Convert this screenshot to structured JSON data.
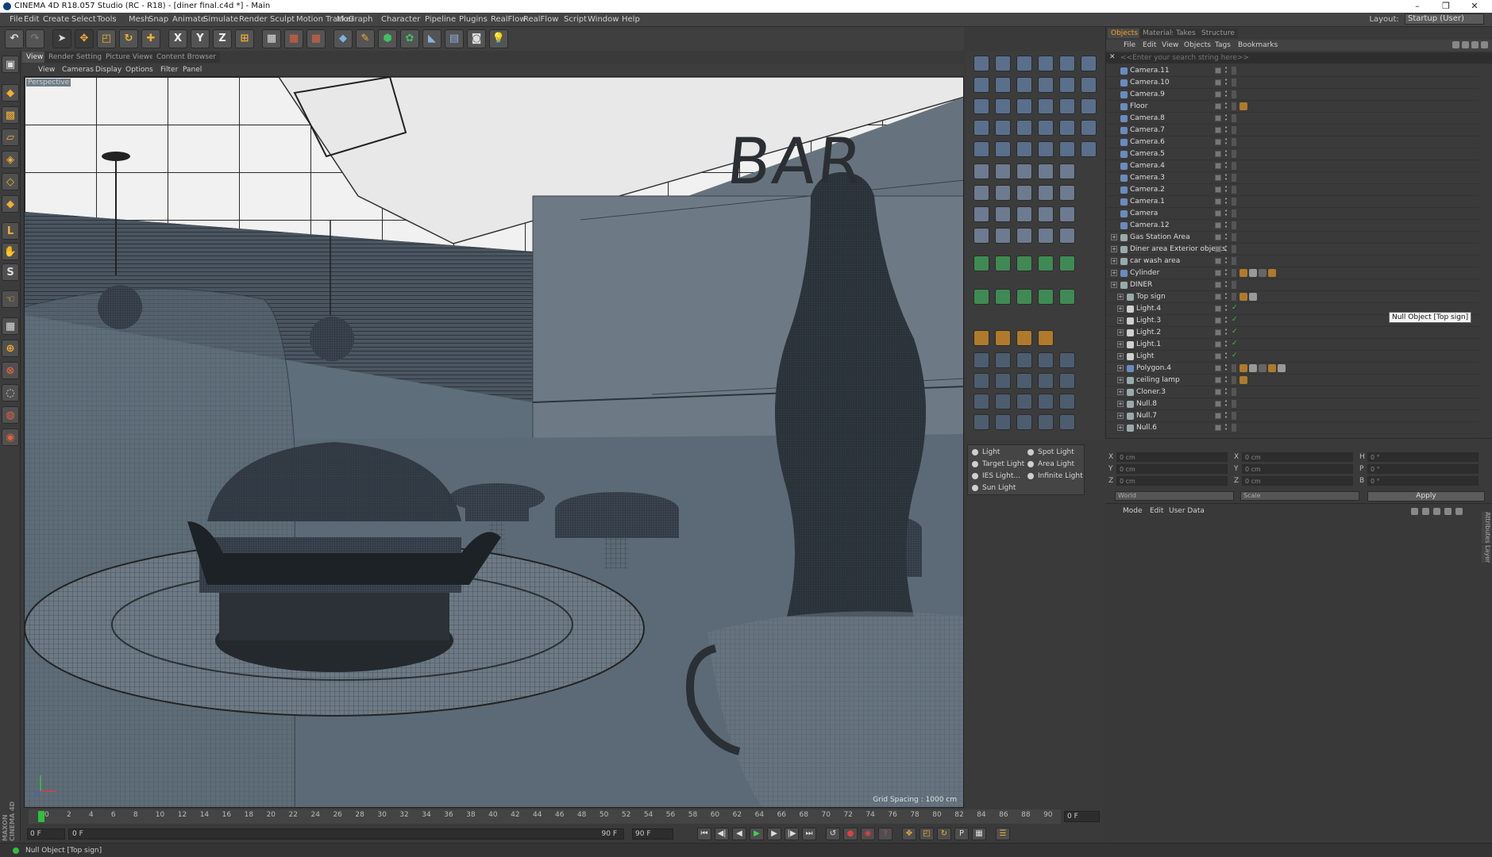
{
  "window": {
    "title": "CINEMA 4D R18.057 Studio (RC - R18) - [diner final.c4d *] - Main"
  },
  "layout": {
    "label": "Layout:",
    "value": "Startup (User)"
  },
  "menu": [
    "File",
    "Edit",
    "Create",
    "Select",
    "Tools",
    "Mesh",
    "Snap",
    "Animate",
    "Simulate",
    "Render",
    "Sculpt",
    "Motion Tracker",
    "MoGraph",
    "Character",
    "Pipeline",
    "Plugins",
    "RealFlow",
    "RealFlow",
    "Script",
    "Window",
    "Help"
  ],
  "viewport_tabs": [
    "View",
    "Render Settings",
    "Picture Viewer",
    "Content Browser"
  ],
  "viewport_menu": [
    "View",
    "Cameras",
    "Display",
    "Options",
    "Filter",
    "Panel"
  ],
  "viewport": {
    "label": "Perspective",
    "grid_spacing": "Grid Spacing : 1000 cm",
    "sign_text": "BAR"
  },
  "toolbar_axes": [
    "X",
    "Y",
    "Z"
  ],
  "lights": [
    {
      "label": "Light"
    },
    {
      "label": "Spot Light"
    },
    {
      "label": "Target Light"
    },
    {
      "label": "Area Light"
    },
    {
      "label": "IES Light..."
    },
    {
      "label": "Infinite Light"
    },
    {
      "label": "Sun Light"
    }
  ],
  "objects_panel": {
    "tabs": [
      "Objects",
      "Materials",
      "Takes",
      "Structure"
    ],
    "menu": [
      "File",
      "Edit",
      "View",
      "Objects",
      "Tags",
      "Bookmarks"
    ],
    "search_placeholder": "<<Enter your search string here>>",
    "rows": [
      {
        "name": "Camera.11",
        "indent": 0,
        "tags": 0
      },
      {
        "name": "Camera.10",
        "indent": 0,
        "tags": 0
      },
      {
        "name": "Camera.9",
        "indent": 0,
        "tags": 0
      },
      {
        "name": "Floor",
        "indent": 0,
        "tags": 1
      },
      {
        "name": "Camera.8",
        "indent": 0,
        "tags": 0
      },
      {
        "name": "Camera.7",
        "indent": 0,
        "tags": 0
      },
      {
        "name": "Camera.6",
        "indent": 0,
        "tags": 0
      },
      {
        "name": "Camera.5",
        "indent": 0,
        "tags": 0
      },
      {
        "name": "Camera.4",
        "indent": 0,
        "tags": 0
      },
      {
        "name": "Camera.3",
        "indent": 0,
        "tags": 0
      },
      {
        "name": "Camera.2",
        "indent": 0,
        "tags": 0
      },
      {
        "name": "Camera.1",
        "indent": 0,
        "tags": 0
      },
      {
        "name": "Camera",
        "indent": 0,
        "tags": 0
      },
      {
        "name": "Camera.12",
        "indent": 0,
        "tags": 0
      },
      {
        "name": "Gas Station Area",
        "indent": 0,
        "tags": 0
      },
      {
        "name": "Diner area Exterior objects",
        "indent": 0,
        "tags": 0
      },
      {
        "name": "car wash area",
        "indent": 0,
        "tags": 0
      },
      {
        "name": "Cylinder",
        "indent": 0,
        "tags": 4
      },
      {
        "name": "DINER",
        "indent": 0,
        "tags": 0
      },
      {
        "name": "Top sign",
        "indent": 1,
        "tags": 2
      },
      {
        "name": "Light.4",
        "indent": 1,
        "tags": 0
      },
      {
        "name": "Light.3",
        "indent": 1,
        "tags": 0
      },
      {
        "name": "Light.2",
        "indent": 1,
        "tags": 0
      },
      {
        "name": "Light.1",
        "indent": 1,
        "tags": 0
      },
      {
        "name": "Light",
        "indent": 1,
        "tags": 0
      },
      {
        "name": "Polygon.4",
        "indent": 1,
        "tags": 5
      },
      {
        "name": "ceiling lamp",
        "indent": 1,
        "tags": 1
      },
      {
        "name": "Cloner.3",
        "indent": 1,
        "tags": 0
      },
      {
        "name": "Null.8",
        "indent": 1,
        "tags": 0
      },
      {
        "name": "Null.7",
        "indent": 1,
        "tags": 0
      },
      {
        "name": "Null.6",
        "indent": 1,
        "tags": 0
      }
    ]
  },
  "tooltip": "Null Object [Top sign]",
  "coords": {
    "rows": [
      {
        "a": "X",
        "av": "0 cm",
        "b": "X",
        "bv": "0 cm",
        "c": "H",
        "cv": "0 °"
      },
      {
        "a": "Y",
        "av": "0 cm",
        "b": "Y",
        "bv": "0 cm",
        "c": "P",
        "cv": "0 °"
      },
      {
        "a": "Z",
        "av": "0 cm",
        "b": "Z",
        "bv": "0 cm",
        "c": "B",
        "cv": "0 °"
      }
    ],
    "space": "World",
    "mode": "Scale",
    "apply": "Apply"
  },
  "attributes": {
    "menu": [
      "Mode",
      "Edit",
      "User Data"
    ],
    "side_tabs": [
      "Attributes",
      "Layer"
    ]
  },
  "timeline": {
    "ticks": [
      "0",
      "2",
      "4",
      "6",
      "8",
      "10",
      "12",
      "14",
      "16",
      "18",
      "20",
      "22",
      "24",
      "26",
      "28",
      "30",
      "32",
      "34",
      "36",
      "38",
      "40",
      "42",
      "44",
      "46",
      "48",
      "50",
      "52",
      "54",
      "56",
      "58",
      "60",
      "62",
      "64",
      "66",
      "68",
      "70",
      "72",
      "74",
      "76",
      "78",
      "80",
      "82",
      "84",
      "86",
      "88",
      "90"
    ],
    "current_frame": "0 F"
  },
  "transport": {
    "start": "0 F",
    "start2": "0 F",
    "end": "90 F",
    "end2": "90 F"
  },
  "status": {
    "text": "Null Object [Top sign]"
  },
  "brand": {
    "text": "MAXON CINEMA 4D"
  }
}
